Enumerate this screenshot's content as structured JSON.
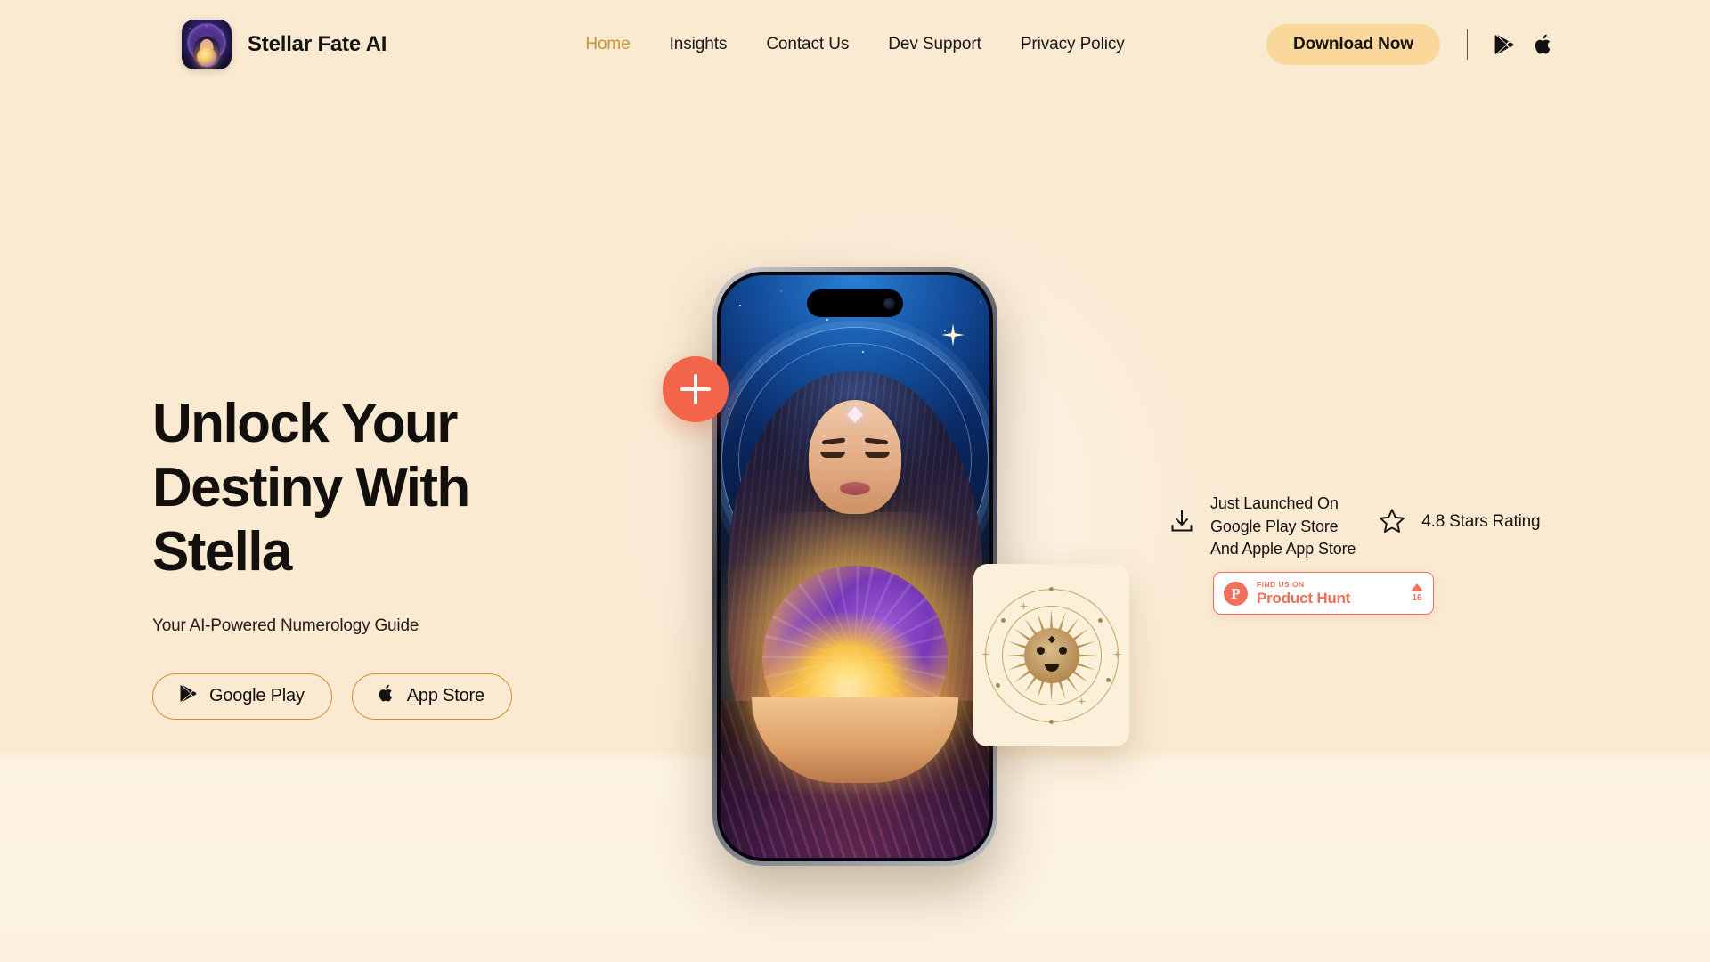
{
  "brand": {
    "name": "Stellar Fate AI",
    "logo_icon": "app-logo-mystic-woman-icon"
  },
  "nav": {
    "items": [
      {
        "label": "Home",
        "active": true
      },
      {
        "label": "Insights",
        "active": false
      },
      {
        "label": "Contact Us",
        "active": false
      },
      {
        "label": "Dev Support",
        "active": false
      },
      {
        "label": "Privacy Policy",
        "active": false
      }
    ],
    "download_button": "Download Now",
    "google_play_icon": "google-play-icon",
    "apple_icon": "apple-logo-icon"
  },
  "hero": {
    "headline_line1": "Unlock Your",
    "headline_line2": "Destiny With",
    "headline_line3": "Stella",
    "subtitle": "Your AI-Powered Numerology Guide",
    "buttons": [
      {
        "label": "Google Play",
        "icon": "google-play-icon"
      },
      {
        "label": "App Store",
        "icon": "apple-logo-icon"
      }
    ]
  },
  "floating": {
    "plus_button_icon": "plus-icon",
    "sun_card_icon": "sun-face-orbit-icon"
  },
  "info": {
    "launch": {
      "icon": "download-icon",
      "text": "Just Launched On\nGoogle Play Store\nAnd Apple App Store"
    },
    "rating": {
      "icon": "star-outline-icon",
      "text": "4.8 Stars Rating"
    }
  },
  "product_hunt": {
    "logo_letter": "P",
    "small_label": "FIND US ON",
    "big_label": "Product Hunt",
    "upvote_count": "16",
    "upvote_icon": "upvote-triangle-icon"
  },
  "colors": {
    "background": "#faead2",
    "accent_gold": "#c79232",
    "button_amber": "#fad79a",
    "border_gold": "#d08f2d",
    "coral": "#f2654a",
    "product_hunt": "#f0705a",
    "text": "#14110e"
  }
}
